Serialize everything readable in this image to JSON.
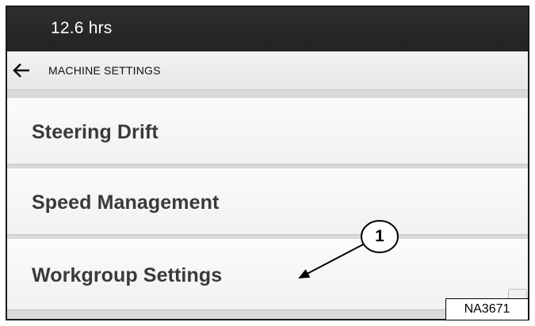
{
  "status_bar": {
    "hours": "12.6 hrs"
  },
  "header": {
    "back_icon": "left-arrow-icon",
    "title": "MACHINE SETTINGS"
  },
  "menu": {
    "items": [
      {
        "label": "Steering Drift"
      },
      {
        "label": "Speed Management"
      },
      {
        "label": "Workgroup Settings"
      }
    ]
  },
  "callout": {
    "number": "1"
  },
  "figure_id": "NA3671",
  "colors": {
    "status_bar": "#282828",
    "header_bar": "#ececec",
    "item_background": "#f6f6f6",
    "item_text": "#3a3a3a"
  }
}
